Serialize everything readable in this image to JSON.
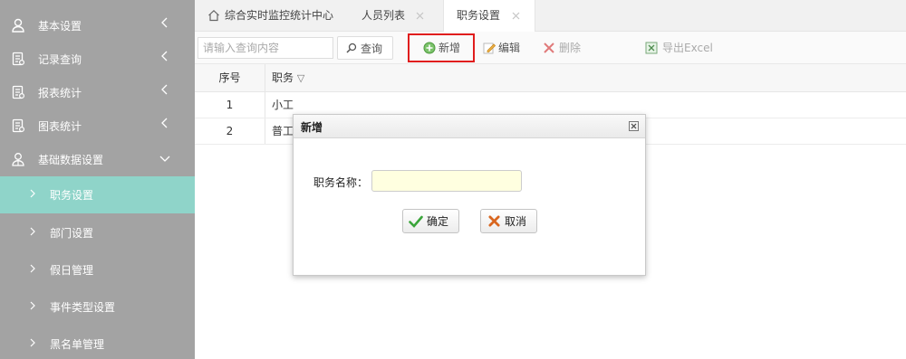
{
  "sidebar": {
    "menus": [
      {
        "label": "基本设置",
        "icon": "user-icon",
        "arrow": "chevron-left-icon"
      },
      {
        "label": "记录查询",
        "icon": "document-icon",
        "arrow": "chevron-left-icon"
      },
      {
        "label": "报表统计",
        "icon": "document-icon",
        "arrow": "chevron-left-icon"
      },
      {
        "label": "图表统计",
        "icon": "document-icon",
        "arrow": "chevron-left-icon"
      },
      {
        "label": "基础数据设置",
        "icon": "users-icon",
        "arrow": "chevron-down-icon"
      }
    ],
    "submenus": [
      {
        "label": "职务设置",
        "active": true
      },
      {
        "label": "部门设置",
        "active": false
      },
      {
        "label": "假日管理",
        "active": false
      },
      {
        "label": "事件类型设置",
        "active": false
      },
      {
        "label": "黑名单管理",
        "active": false
      }
    ]
  },
  "tabs": [
    {
      "label": "综合实时监控统计中心",
      "icon": "home-icon",
      "closable": false,
      "active": false
    },
    {
      "label": "人员列表",
      "closable": true,
      "active": false
    },
    {
      "label": "职务设置",
      "closable": true,
      "active": true
    }
  ],
  "toolbar": {
    "search_placeholder": "请输入查询内容",
    "query_label": "查询",
    "add_label": "新增",
    "edit_label": "编辑",
    "delete_label": "删除",
    "export_label": "导出Excel"
  },
  "grid": {
    "headers": {
      "num": "序号",
      "job": "职务",
      "sort_icon": "▽"
    },
    "rows": [
      {
        "num": "1",
        "job": "小工"
      },
      {
        "num": "2",
        "job": "普工"
      }
    ]
  },
  "dialog": {
    "title": "新增",
    "field_label": "职务名称：",
    "field_value": "",
    "confirm_label": "确定",
    "cancel_label": "取消"
  },
  "colors": {
    "sidebar_bg": "#a3a3a3",
    "sidebar_active": "#8fd4c9",
    "highlight": "#e01d1d"
  }
}
